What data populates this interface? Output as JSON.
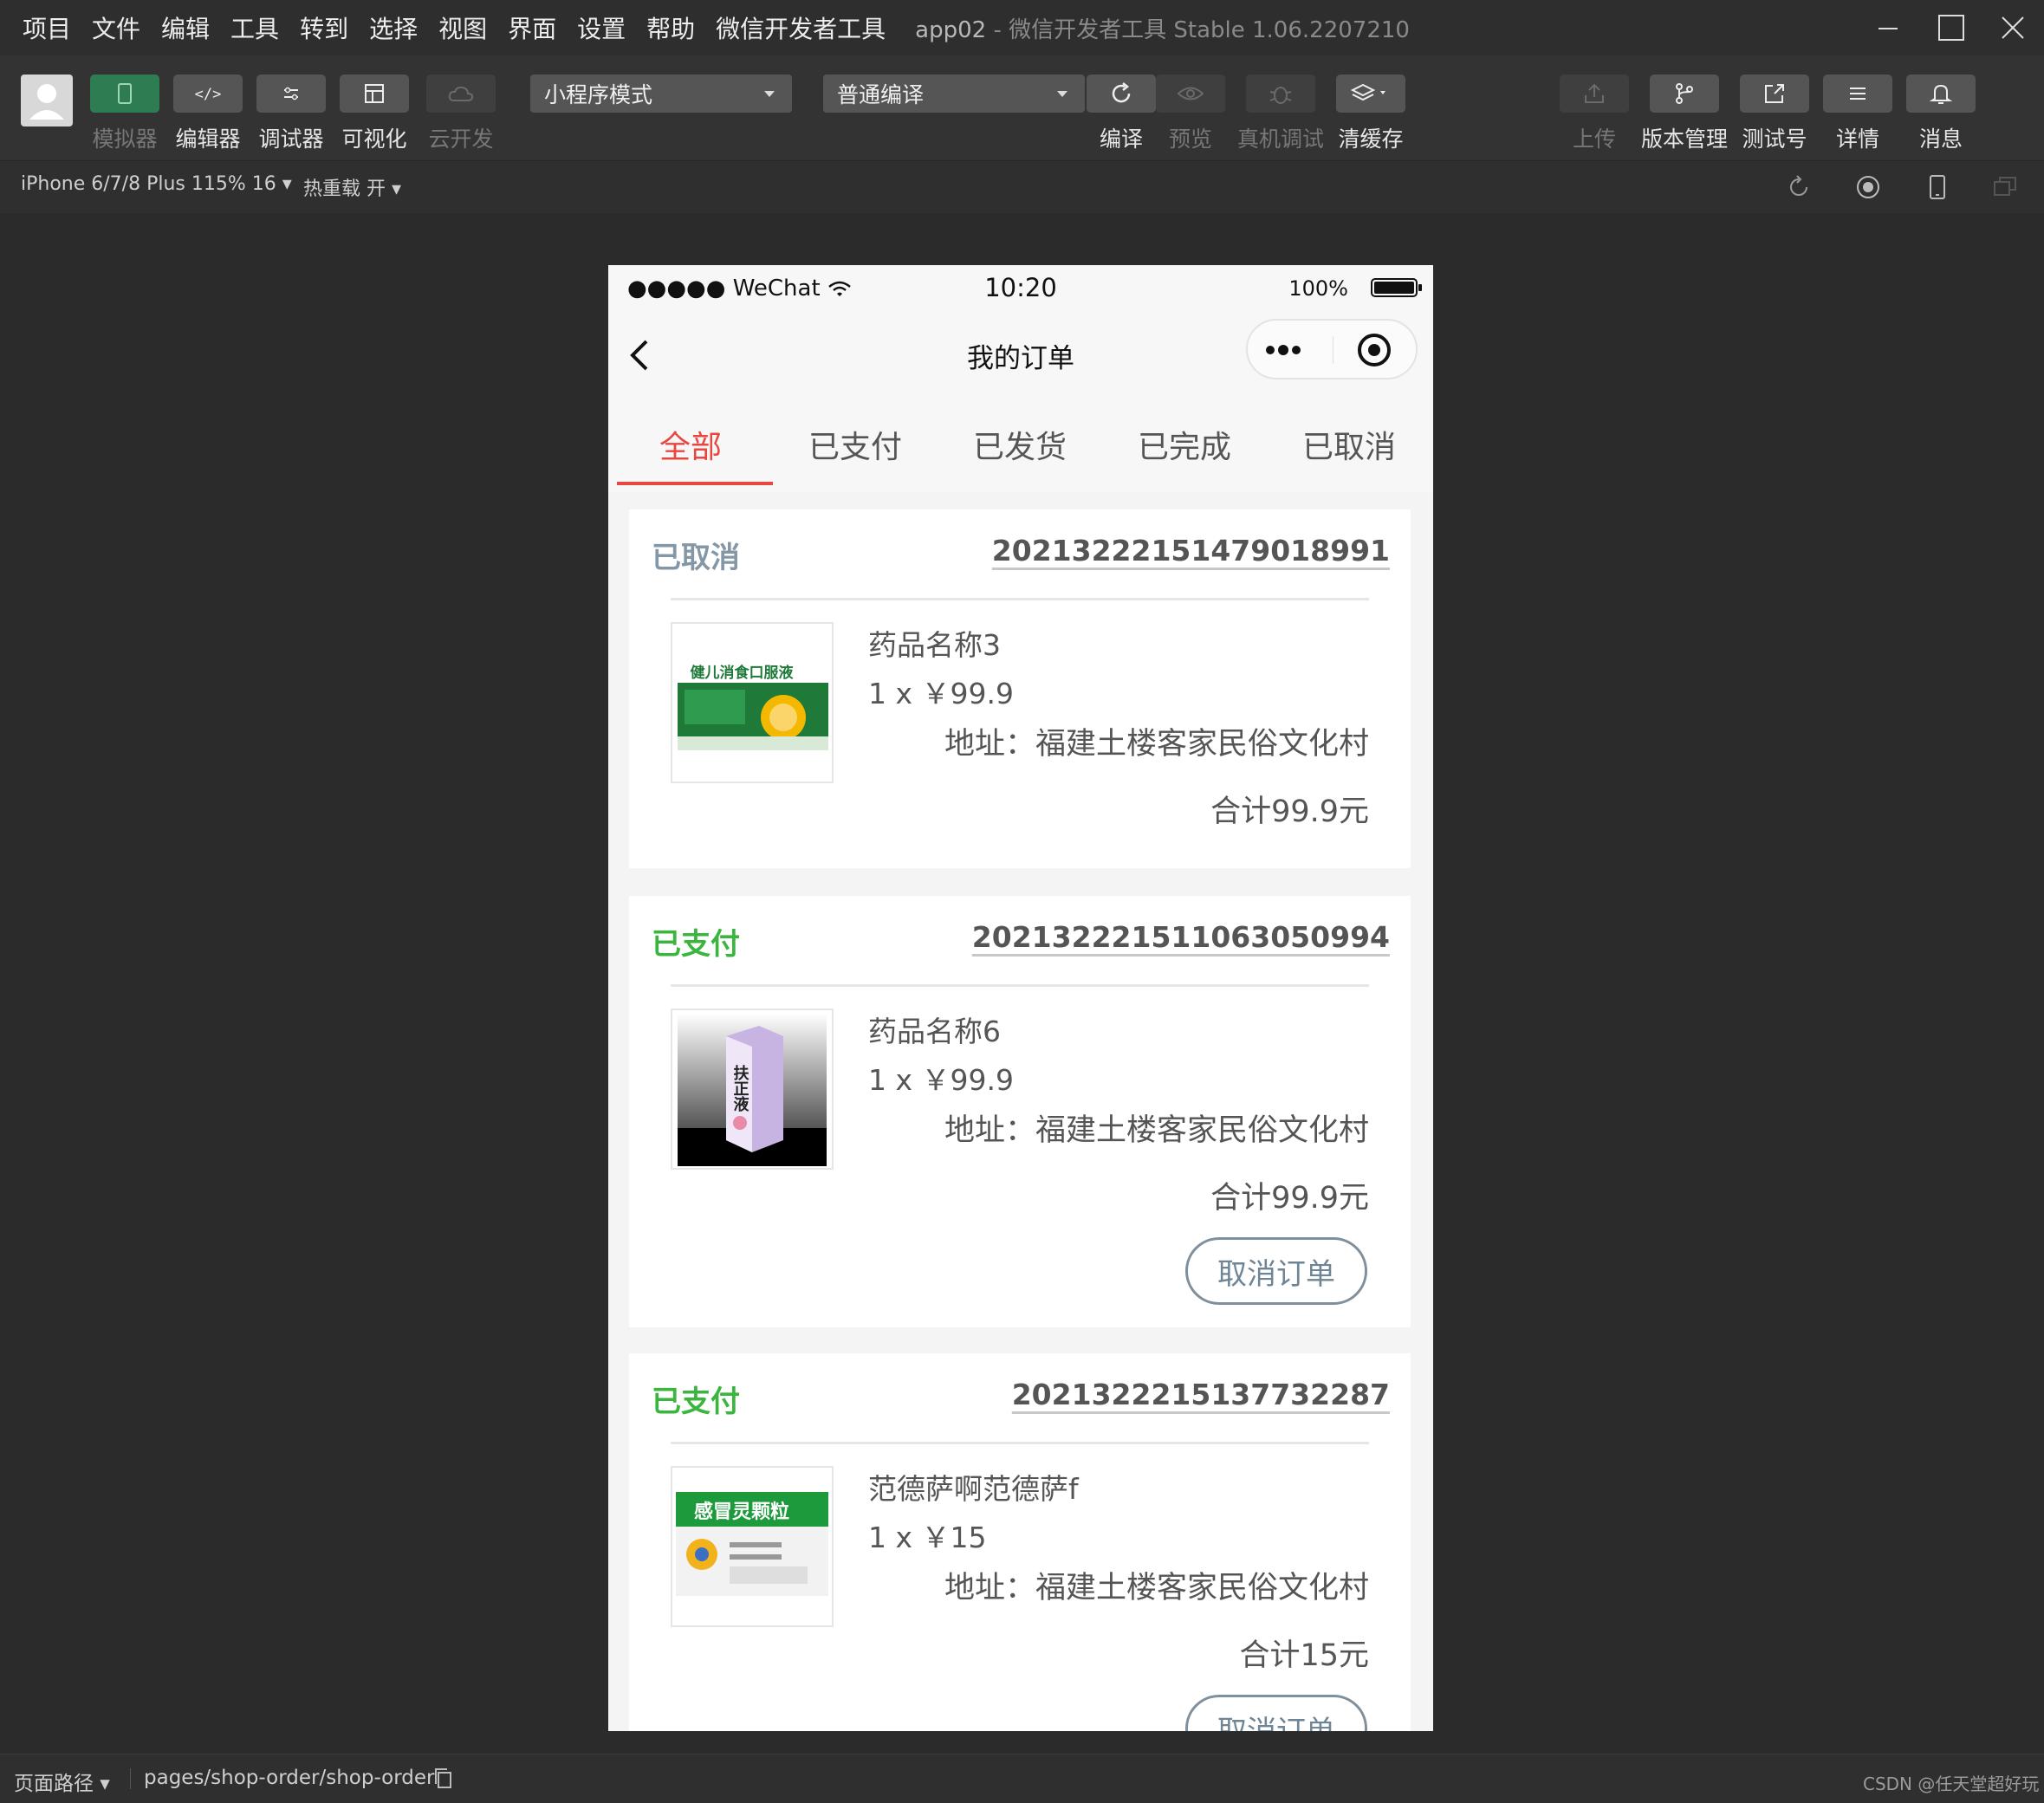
{
  "menu": [
    "项目",
    "文件",
    "编辑",
    "工具",
    "转到",
    "选择",
    "视图",
    "界面",
    "设置",
    "帮助",
    "微信开发者工具"
  ],
  "window": {
    "app": "app02",
    "title": " - 微信开发者工具 Stable 1.06.2207210"
  },
  "toolbar": {
    "simulator": "模拟器",
    "editor": "编辑器",
    "debugger": "调试器",
    "visual": "可视化",
    "cloud": "云开发",
    "mode_select": "小程序模式",
    "compile_select": "普通编译",
    "compile": "编译",
    "preview": "预览",
    "remote_debug": "真机调试",
    "clear_cache": "清缓存",
    "upload": "上传",
    "version": "版本管理",
    "test_id": "测试号",
    "details": "详情",
    "messages": "消息"
  },
  "subbar": {
    "device": "iPhone 6/7/8 Plus 115% 16 ▾",
    "hot_reload": "热重载 开 ▾"
  },
  "phone": {
    "signal": "●●●●● WeChat",
    "time": "10:20",
    "battery": "100%",
    "nav_title": "我的订单",
    "tabs": [
      "全部",
      "已支付",
      "已发货",
      "已完成",
      "已取消"
    ]
  },
  "orders": [
    {
      "status": "已取消",
      "status_color": "#8497a6",
      "order_no": "2021322215147901899​1",
      "name": "药品名称3",
      "qty_price": "1 x ￥99.9",
      "address": "地址：福建土楼客家民俗文化村",
      "total": "合计99.9元",
      "image_text": "健儿消食口服液"
    },
    {
      "status": "已支付",
      "status_color": "#3cb53f",
      "order_no": "20213222151106305099​4",
      "name": "药品名称6",
      "qty_price": "1 x ￥99.9",
      "address": "地址：福建土楼客家民俗文化村",
      "total": "合计99.9元",
      "cancel": "取消订单",
      "image_text": "扶正液"
    },
    {
      "status": "已支付",
      "status_color": "#3cb53f",
      "order_no": "2021322215137732287",
      "name": "范德萨啊范德萨f",
      "qty_price": "1 x ￥15",
      "address": "地址：福建土楼客家民俗文化村",
      "total": "合计15元",
      "cancel": "取消订单",
      "image_text": "感冒灵颗粒"
    }
  ],
  "bottom": {
    "path_label": "页面路径 ▾",
    "path": "pages/shop-order/shop-order",
    "watermark": "CSDN @任天堂超好玩"
  }
}
